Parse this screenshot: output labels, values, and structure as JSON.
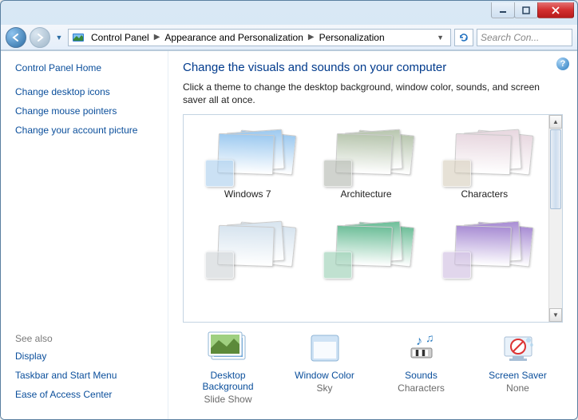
{
  "titlebar": {
    "title": ""
  },
  "breadcrumb": {
    "items": [
      "Control Panel",
      "Appearance and Personalization",
      "Personalization"
    ]
  },
  "search": {
    "placeholder": "Search Con..."
  },
  "sidebar": {
    "home": "Control Panel Home",
    "links": [
      "Change desktop icons",
      "Change mouse pointers",
      "Change your account picture"
    ],
    "see_also_header": "See also",
    "see_also": [
      "Display",
      "Taskbar and Start Menu",
      "Ease of Access Center"
    ]
  },
  "main": {
    "heading": "Change the visuals and sounds on your computer",
    "subtext": "Click a theme to change the desktop background, window color, sounds, and screen saver all at once."
  },
  "themes": [
    {
      "name": "Windows 7",
      "tint": "#9ecaf0",
      "chip": "rgba(160,200,235,0.55)"
    },
    {
      "name": "Architecture",
      "tint": "#b9c7b0",
      "chip": "rgba(170,175,165,0.55)"
    },
    {
      "name": "Characters",
      "tint": "#e8d8e0",
      "chip": "rgba(210,200,180,0.55)"
    },
    {
      "name": "",
      "tint": "#d7e4ef",
      "chip": "rgba(200,205,210,0.55)"
    },
    {
      "name": "",
      "tint": "#6fbf9a",
      "chip": "rgba(140,200,170,0.55)"
    },
    {
      "name": "",
      "tint": "#a98ed4",
      "chip": "rgba(200,180,220,0.55)"
    }
  ],
  "bottom": [
    {
      "label": "Desktop Background",
      "value": "Slide Show",
      "icon": "desktop-background"
    },
    {
      "label": "Window Color",
      "value": "Sky",
      "icon": "window-color"
    },
    {
      "label": "Sounds",
      "value": "Characters",
      "icon": "sounds"
    },
    {
      "label": "Screen Saver",
      "value": "None",
      "icon": "screen-saver"
    }
  ]
}
